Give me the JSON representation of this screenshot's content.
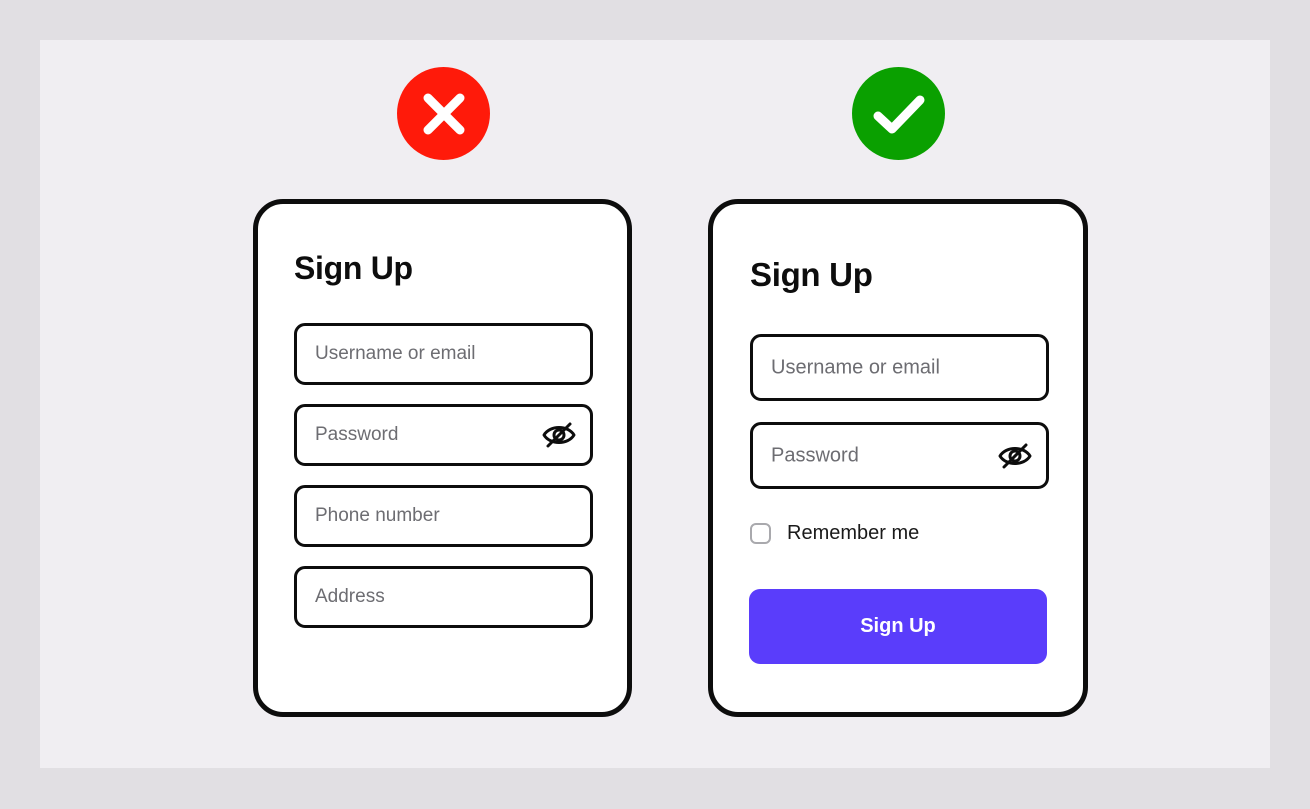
{
  "colors": {
    "page_frame": "#e1dfe3",
    "canvas": "#f0eef2",
    "bad_badge": "#ff1a0a",
    "good_badge": "#0aa000",
    "card_border": "#0d0d0d",
    "placeholder_text": "#6d6d72",
    "button": "#5a3dfb",
    "button_text": "#ffffff"
  },
  "bad_example": {
    "badge_icon": "close-icon",
    "title": "Sign Up",
    "fields": [
      {
        "placeholder": "Username or email"
      },
      {
        "placeholder": "Password",
        "icon": "eye-off-icon"
      },
      {
        "placeholder": "Phone number"
      },
      {
        "placeholder": "Address"
      }
    ]
  },
  "good_example": {
    "badge_icon": "check-icon",
    "title": "Sign Up",
    "fields": [
      {
        "placeholder": "Username or email"
      },
      {
        "placeholder": "Password",
        "icon": "eye-off-icon"
      }
    ],
    "remember_label": "Remember me",
    "remember_checked": false,
    "submit_label": "Sign Up"
  }
}
